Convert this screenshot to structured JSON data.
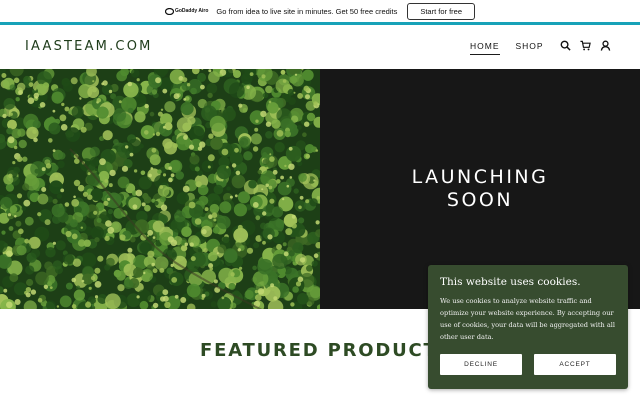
{
  "promo": {
    "brand": "GoDaddy Airo",
    "text": "Go from idea to live site in minutes. Get 50 free credits",
    "cta_label": "Start for free"
  },
  "header": {
    "logo": "IAASTEAM.COM",
    "nav": [
      {
        "label": "HOME",
        "active": true
      },
      {
        "label": "SHOP",
        "active": false
      }
    ],
    "icons": [
      "search-icon",
      "cart-icon",
      "account-icon"
    ]
  },
  "hero": {
    "title_line1": "LAUNCHING",
    "title_line2": "SOON",
    "image": "aerial-forest-photo"
  },
  "featured": {
    "heading": "FEATURED PRODUCT"
  },
  "cookie_banner": {
    "title": "This website uses cookies.",
    "body": "We use cookies to analyze website traffic and optimize your website experience. By accepting our use of cookies, your data will be aggregated with all other user data.",
    "decline_label": "DECLINE",
    "accept_label": "ACCEPT"
  },
  "colors": {
    "accent_bar": "#17a2b8",
    "brand_green": "#1e3b1a",
    "heading_green": "#2e4b24",
    "cookie_bg": "#374c2f",
    "hero_dark": "#171717"
  }
}
